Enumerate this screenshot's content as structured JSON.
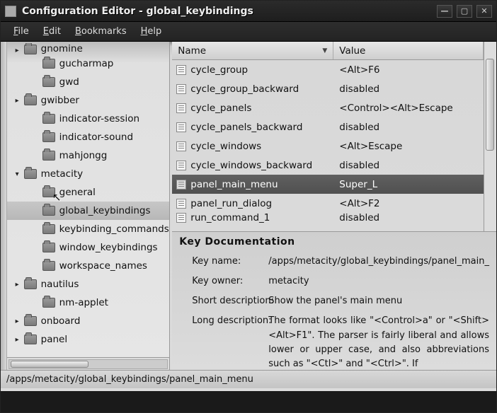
{
  "window": {
    "title": "Configuration Editor - global_keybindings"
  },
  "menubar": {
    "file": "File",
    "edit": "Edit",
    "bookmarks": "Bookmarks",
    "help": "Help"
  },
  "tree": {
    "items": [
      {
        "label": "gnomine",
        "depth": 1,
        "expandable": true,
        "expanded": false,
        "partial": true
      },
      {
        "label": "gucharmap",
        "depth": 2,
        "expandable": false
      },
      {
        "label": "gwd",
        "depth": 2,
        "expandable": false
      },
      {
        "label": "gwibber",
        "depth": 1,
        "expandable": true,
        "expanded": false
      },
      {
        "label": "indicator-session",
        "depth": 2,
        "expandable": false
      },
      {
        "label": "indicator-sound",
        "depth": 2,
        "expandable": false
      },
      {
        "label": "mahjongg",
        "depth": 2,
        "expandable": false
      },
      {
        "label": "metacity",
        "depth": 1,
        "expandable": true,
        "expanded": true
      },
      {
        "label": "general",
        "depth": 2,
        "expandable": false
      },
      {
        "label": "global_keybindings",
        "depth": 2,
        "expandable": false,
        "selected": true
      },
      {
        "label": "keybinding_commands",
        "depth": 2,
        "expandable": false
      },
      {
        "label": "window_keybindings",
        "depth": 2,
        "expandable": false
      },
      {
        "label": "workspace_names",
        "depth": 2,
        "expandable": false
      },
      {
        "label": "nautilus",
        "depth": 1,
        "expandable": true,
        "expanded": false
      },
      {
        "label": "nm-applet",
        "depth": 2,
        "expandable": false
      },
      {
        "label": "onboard",
        "depth": 1,
        "expandable": true,
        "expanded": false
      },
      {
        "label": "panel",
        "depth": 1,
        "expandable": true,
        "expanded": false
      }
    ]
  },
  "grid": {
    "col_name": "Name",
    "col_value": "Value",
    "rows": [
      {
        "name": "cycle_group",
        "value": "<Alt>F6"
      },
      {
        "name": "cycle_group_backward",
        "value": "disabled"
      },
      {
        "name": "cycle_panels",
        "value": "<Control><Alt>Escape"
      },
      {
        "name": "cycle_panels_backward",
        "value": "disabled"
      },
      {
        "name": "cycle_windows",
        "value": "<Alt>Escape"
      },
      {
        "name": "cycle_windows_backward",
        "value": "disabled"
      },
      {
        "name": "panel_main_menu",
        "value": "Super_L",
        "selected": true
      },
      {
        "name": "panel_run_dialog",
        "value": "<Alt>F2"
      },
      {
        "name": "run_command_1",
        "value": "disabled",
        "partial": true
      }
    ]
  },
  "doc": {
    "title": "Key Documentation",
    "key_name_label": "Key name:",
    "key_name": "/apps/metacity/global_keybindings/panel_main_",
    "key_owner_label": "Key owner:",
    "key_owner": "metacity",
    "short_label": "Short description:",
    "short": "Show the panel's main menu",
    "long_label": "Long description:",
    "long": "The format looks like \"<Control>a\" or \"<Shift><Alt>F1\". The parser is fairly liberal and allows lower or upper case, and also abbreviations such as \"<Ctl>\" and \"<Ctrl>\". If"
  },
  "statusbar": {
    "path": "/apps/metacity/global_keybindings/panel_main_menu"
  }
}
